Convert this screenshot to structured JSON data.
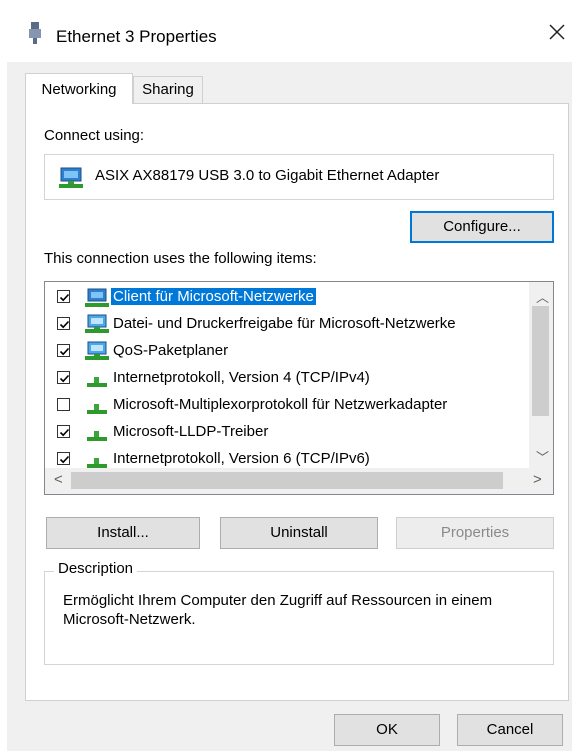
{
  "window": {
    "title": "Ethernet 3 Properties"
  },
  "tabs": [
    {
      "label": "Networking",
      "active": true
    },
    {
      "label": "Sharing",
      "active": false
    }
  ],
  "connect_using": {
    "label": "Connect using:",
    "adapter": "ASIX AX88179 USB 3.0 to Gigabit Ethernet Adapter",
    "configure_label": "Configure..."
  },
  "items": {
    "label": "This connection uses the following items:",
    "rows": [
      {
        "text": "Client für Microsoft-Netzwerke",
        "checked": true,
        "icon": "network-client-icon",
        "selected": true
      },
      {
        "text": "Datei- und Druckerfreigabe für Microsoft-Netzwerke",
        "checked": true,
        "icon": "network-service-icon",
        "selected": false
      },
      {
        "text": "QoS-Paketplaner",
        "checked": true,
        "icon": "network-service-icon",
        "selected": false
      },
      {
        "text": "Internetprotokoll, Version 4 (TCP/IPv4)",
        "checked": true,
        "icon": "protocol-icon",
        "selected": false
      },
      {
        "text": "Microsoft-Multiplexorprotokoll für Netzwerkadapter",
        "checked": false,
        "icon": "protocol-icon",
        "selected": false
      },
      {
        "text": "Microsoft-LLDP-Treiber",
        "checked": true,
        "icon": "protocol-icon",
        "selected": false
      },
      {
        "text": "Internetprotokoll, Version 6 (TCP/IPv6)",
        "checked": true,
        "icon": "protocol-icon",
        "selected": false
      }
    ]
  },
  "buttons": {
    "install": "Install...",
    "uninstall": "Uninstall",
    "properties": "Properties",
    "ok": "OK",
    "cancel": "Cancel"
  },
  "description": {
    "title": "Description",
    "text": "Ermöglicht Ihrem Computer den Zugriff auf Ressourcen in einem Microsoft-Netzwerk."
  },
  "colors": {
    "accent": "#0078d7",
    "selection": "#0078d7",
    "button_face": "#e1e1e1"
  }
}
